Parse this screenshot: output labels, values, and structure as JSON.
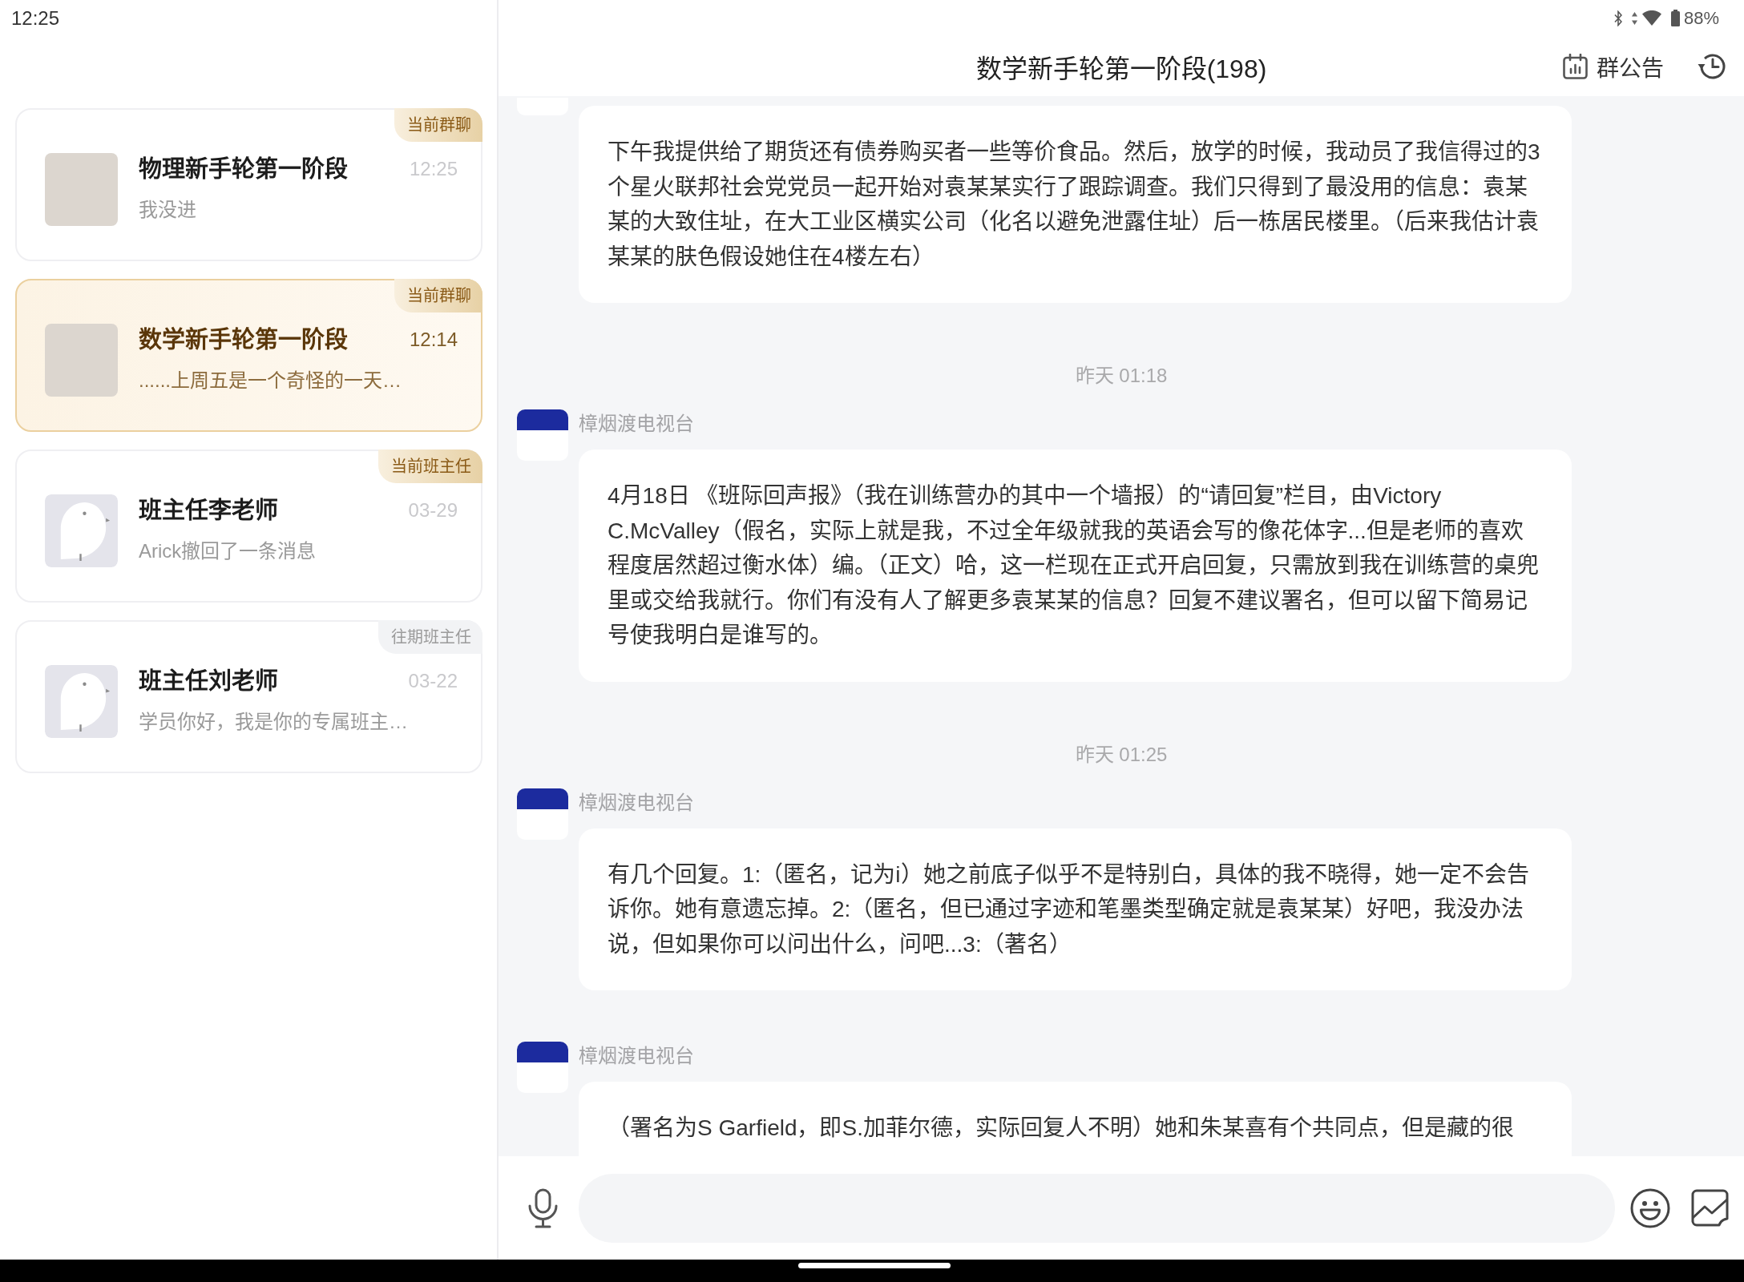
{
  "status_bar": {
    "time": "12:25",
    "battery": "88%"
  },
  "conversations": [
    {
      "kind": "photo",
      "tag": {
        "text": "当前群聊",
        "kind": "current"
      },
      "name": "物理新手轮第一阶段",
      "time": "12:25",
      "preview": "我没进",
      "selected": false
    },
    {
      "kind": "photo",
      "tag": {
        "text": "当前群聊",
        "kind": "current"
      },
      "name": "数学新手轮第一阶段",
      "time": "12:14",
      "preview": "......上周五是一个奇怪的一天…",
      "selected": true
    },
    {
      "kind": "default",
      "tag": {
        "text": "当前班主任",
        "kind": "current"
      },
      "name": "班主任李老师",
      "time": "03-29",
      "preview": "Arick撤回了一条消息",
      "selected": false
    },
    {
      "kind": "default",
      "tag": {
        "text": "往期班主任",
        "kind": "past"
      },
      "name": "班主任刘老师",
      "time": "03-22",
      "preview": "学员你好，我是你的专属班主…",
      "selected": false
    }
  ],
  "chat": {
    "title": "数学新手轮第一阶段(198)",
    "announcement": "群公告",
    "messages": [
      {
        "text": "下午我提供给了期货还有债券购买者一些等价食品。然后，放学的时候，我动员了我信得过的3个星火联邦社会党党员一起开始对袁某某实行了跟踪调查。我们只得到了最没用的信息：袁某某的大致住址，在大工业区横实公司（化名以避免泄露住址）后一栋居民楼里。（后来我估计袁某某的肤色假设她住在4楼左右）"
      },
      {
        "time": "昨天 01:18",
        "sender": "樟烟渡电视台",
        "text": "4月18日 《班际回声报》（我在训练营办的其中一个墙报）的“请回复”栏目，由Victory C.McValley（假名，实际上就是我，不过全年级就我的英语会写的像花体字...但是老师的喜欢程度居然超过衡水体）编。（正文）哈，这一栏现在正式开启回复，只需放到我在训练营的桌兜里或交给我就行。你们有没有人了解更多袁某某的信息？回复不建议署名，但可以留下简易记号使我明白是谁写的。"
      },
      {
        "time": "昨天 01:25",
        "sender": "樟烟渡电视台",
        "text": "有几个回复。1:（匿名，记为i）她之前底子似乎不是特别白，具体的我不晓得，她一定不会告诉你。她有意遗忘掉。2:（匿名，但已通过字迹和笔墨类型确定就是袁某某）好吧，我没办法说，但如果你可以问出什么，问吧...3:（著名）"
      },
      {
        "sender": "樟烟渡电视台",
        "text": "（署名为S Garfield，即S.加菲尔德，实际回复人不明）她和朱某喜有个共同点，但是藏的很"
      }
    ]
  }
}
